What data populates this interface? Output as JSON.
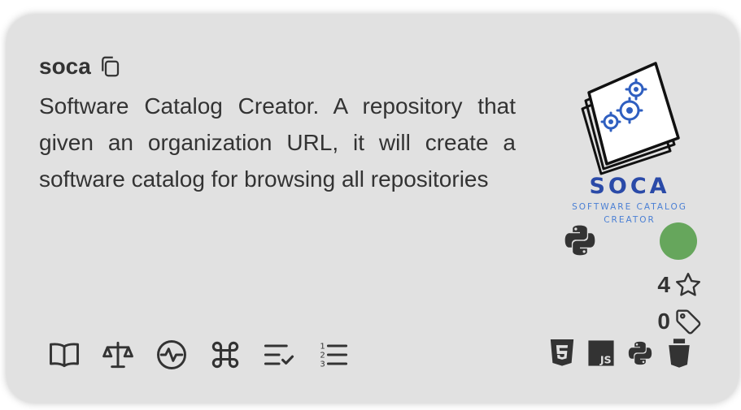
{
  "repo": {
    "name": "soca",
    "description": "Software Catalog Creator. A repository that given an organization URL, it will create a software catalog for browsing all repositories"
  },
  "logo": {
    "title": "SOCA",
    "subtitle_line1": "SOFTWARE CATALOG",
    "subtitle_line2": "CREATOR",
    "colors": {
      "title": "#2a4aa8",
      "subtitle": "#4a7fd4",
      "gear": "#2f5fc0"
    }
  },
  "language": {
    "icon": "python-icon"
  },
  "status": {
    "color": "#66a65c"
  },
  "stats": {
    "stars": "4",
    "tags": "0"
  },
  "actions": [
    {
      "name": "readme-icon"
    },
    {
      "name": "license-icon"
    },
    {
      "name": "activity-icon"
    },
    {
      "name": "command-icon"
    },
    {
      "name": "checklist-icon"
    },
    {
      "name": "numbered-list-icon"
    }
  ],
  "technologies": [
    "html5-icon",
    "javascript-icon",
    "python-icon",
    "css-icon"
  ]
}
